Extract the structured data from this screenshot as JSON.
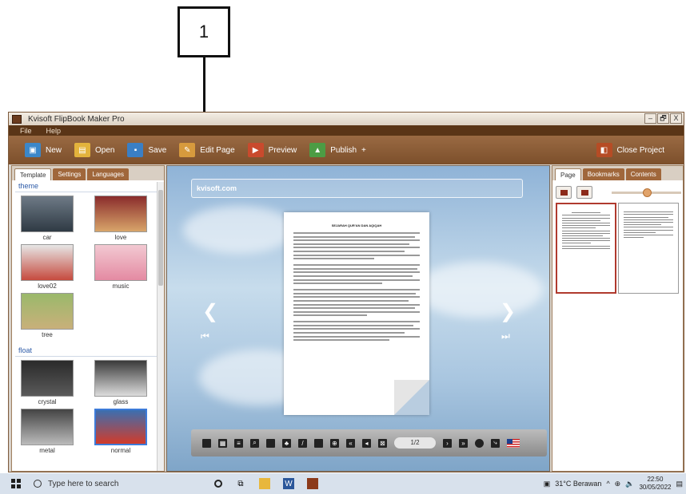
{
  "callout": {
    "number": "1"
  },
  "window": {
    "title": "Kvisoft FlipBook Maker Pro",
    "controls": [
      "–",
      "🗗",
      "X"
    ]
  },
  "menu": {
    "items": [
      "File",
      "Help"
    ]
  },
  "toolbar": {
    "new_label": "New",
    "open_label": "Open",
    "save_label": "Save",
    "edit_page_label": "Edit Page",
    "preview_label": "Preview",
    "publish_label": "Publish",
    "publish_arrow": "+",
    "close_project_label": "Close Project"
  },
  "left_panel": {
    "tabs": [
      "Template",
      "Settings",
      "Languages"
    ],
    "theme_section": "theme",
    "float_section": "float",
    "theme_items": [
      "car",
      "love",
      "love02",
      "music",
      "tree"
    ],
    "float_items": [
      "crystal",
      "glass",
      "metal",
      "normal"
    ]
  },
  "center": {
    "url": "kvisoft.com",
    "page_title": "SEJARAH QUR'AN DAN AQIQAH",
    "page_counter": "1/2"
  },
  "right_panel": {
    "tabs": [
      "Page",
      "Bookmarks",
      "Contents"
    ],
    "zoom_level": 0.5
  },
  "taskbar": {
    "search_placeholder": "Type here to search",
    "weather": "31°C Berawan",
    "time": "22:50",
    "date": "30/05/2022"
  },
  "colors": {
    "toolbar": "#8a5a34",
    "menubar": "#5a3517",
    "selection_blue": "#3d7bd9",
    "selection_red": "#b03a2e"
  }
}
